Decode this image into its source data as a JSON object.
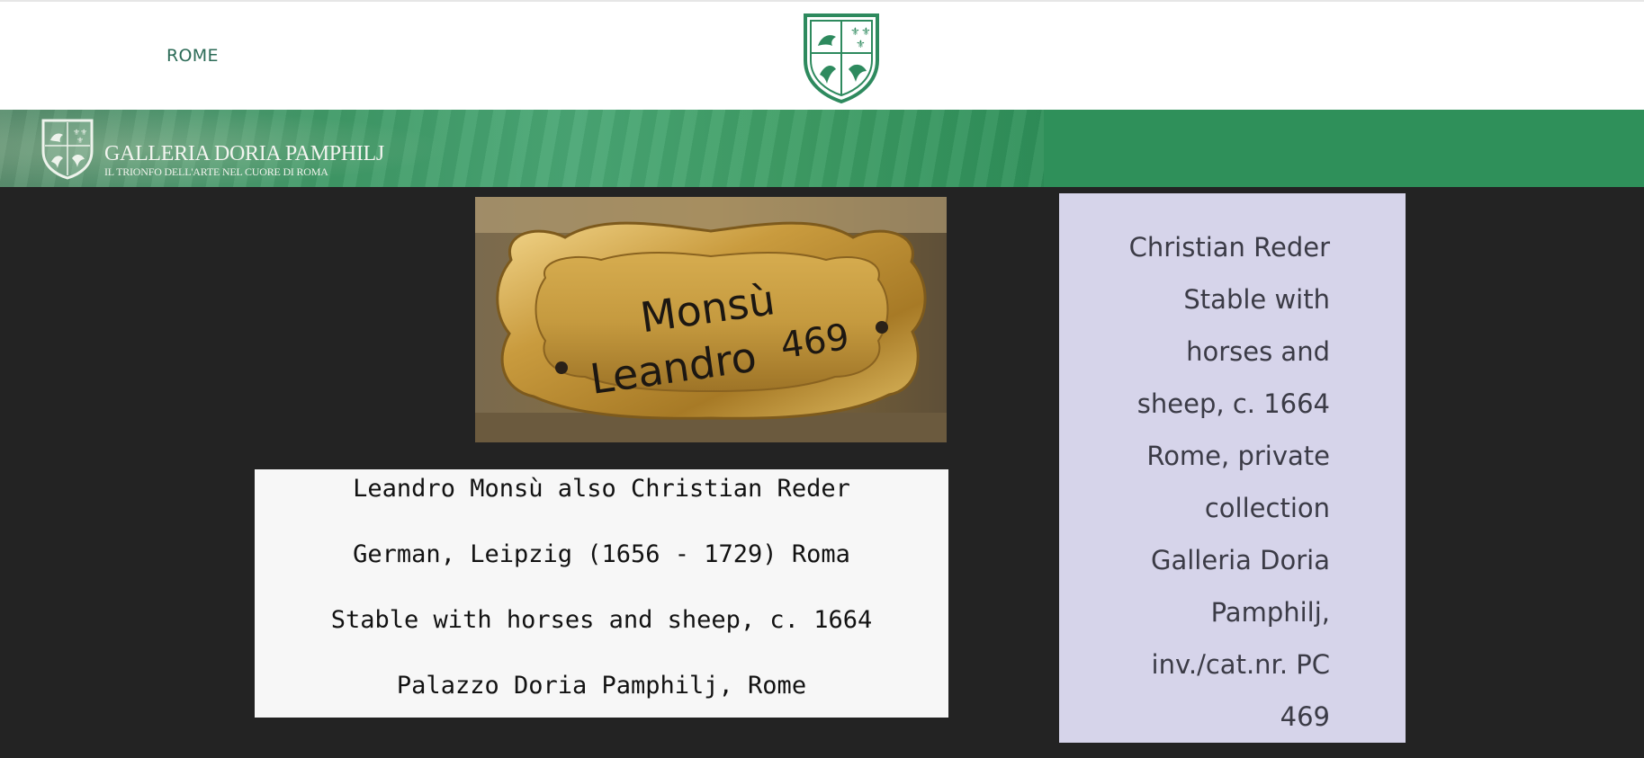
{
  "nav": {
    "rome_label": "ROME"
  },
  "banner": {
    "title": "GALLERIA DORIA PAMPHILJ",
    "subtitle": "IL TRIONFO DELL'ARTE NEL CUORE DI ROMA",
    "color": "#2f905a"
  },
  "photo": {
    "label_line1": "Monsù",
    "label_line2": "Leandro",
    "label_number": "469"
  },
  "caption": {
    "lines": [
      "Leandro Monsù also Christian Reder",
      "German, Leipzig (1656 - 1729) Roma",
      "Stable with horses and sheep, c. 1664",
      "Palazzo Doria Pamphilj, Rome"
    ]
  },
  "sidebox": {
    "lines": [
      "Christian Reder",
      "Stable with",
      "horses and",
      "sheep, c. 1664",
      "Rome, private",
      "collection",
      "Galleria Doria",
      "Pamphilj,",
      "inv./cat.nr. PC",
      "469"
    ],
    "background": "#d6d4ea"
  },
  "icons": {
    "center": "coat-of-arms-icon",
    "banner": "coat-of-arms-icon"
  }
}
